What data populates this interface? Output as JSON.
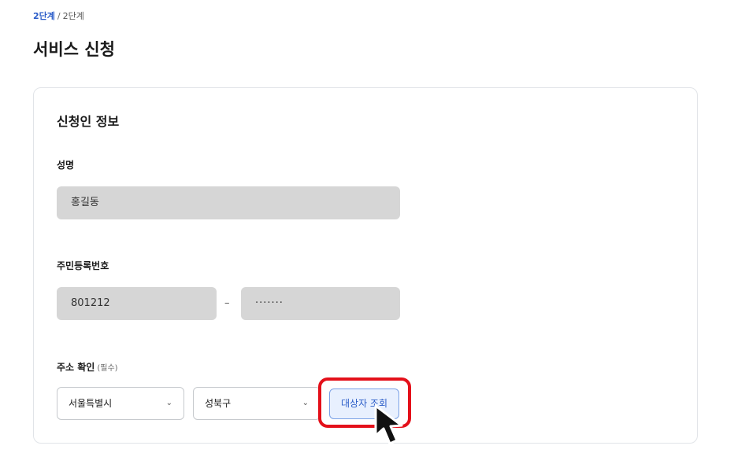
{
  "breadcrumb": {
    "current": "2단계",
    "separator": "/",
    "total": "2단계"
  },
  "page": {
    "title": "서비스 신청"
  },
  "section": {
    "title": "신청인 정보"
  },
  "name_field": {
    "label": "성명",
    "value": "홍길동"
  },
  "rrn_field": {
    "label": "주민등록번호",
    "front": "801212",
    "separator": "–",
    "back": "·······"
  },
  "address": {
    "label": "주소 확인",
    "required": "(필수)",
    "city": "서울특별시",
    "district": "성북구",
    "search_button": "대상자 조회"
  },
  "colors": {
    "accent": "#2a5cc8",
    "highlight": "#e4101a",
    "field_bg": "#d6d6d6"
  }
}
